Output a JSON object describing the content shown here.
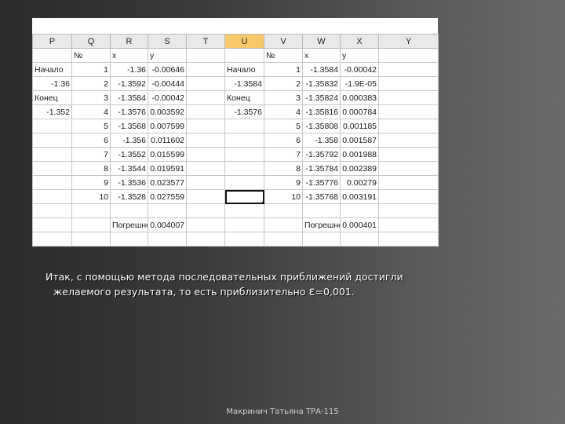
{
  "sheet": {
    "columns": [
      "P",
      "Q",
      "R",
      "S",
      "T",
      "U",
      "V",
      "W",
      "X",
      "Y"
    ],
    "highlighted_column": "U",
    "rows": [
      [
        "",
        "№",
        "x",
        "y",
        "",
        "",
        "№",
        "x",
        "y",
        ""
      ],
      [
        "Начало",
        "1",
        "-1.36",
        "-0.00646",
        "",
        "Начало",
        "1",
        "-1.3584",
        "-0.00042",
        ""
      ],
      [
        "-1.36",
        "2",
        "-1.3592",
        "-0.00444",
        "",
        "-1.3584",
        "2",
        "-1.35832",
        "-1.9E-05",
        ""
      ],
      [
        "Конец",
        "3",
        "-1.3584",
        "-0.00042",
        "",
        "Конец",
        "3",
        "-1.35824",
        "0.000383",
        ""
      ],
      [
        "-1.352",
        "4",
        "-1.3576",
        "0.003592",
        "",
        "-1.3576",
        "4",
        "-1.35816",
        "0.000784",
        ""
      ],
      [
        "",
        "5",
        "-1.3568",
        "0.007599",
        "",
        "",
        "5",
        "-1.35808",
        "0.001185",
        ""
      ],
      [
        "",
        "6",
        "-1.356",
        "0.011602",
        "",
        "",
        "6",
        "-1.358",
        "0.001587",
        ""
      ],
      [
        "",
        "7",
        "-1.3552",
        "0.015599",
        "",
        "",
        "7",
        "-1.35792",
        "0.001988",
        ""
      ],
      [
        "",
        "8",
        "-1.3544",
        "0.019591",
        "",
        "",
        "8",
        "-1.35784",
        "0.002389",
        ""
      ],
      [
        "",
        "9",
        "-1.3536",
        "0.023577",
        "",
        "",
        "9",
        "-1.35776",
        "0.00279",
        ""
      ],
      [
        "",
        "10",
        "-1.3528",
        "0.027559",
        "",
        "",
        "10",
        "-1.35768",
        "0.003191",
        ""
      ],
      [
        "",
        "",
        "",
        "",
        "",
        "",
        "",
        "",
        "",
        ""
      ],
      [
        "",
        "",
        "Погрешность",
        "0.004007",
        "",
        "",
        "",
        "Погрешность",
        "0.000401",
        ""
      ],
      [
        "",
        "",
        "",
        "",
        "",
        "",
        "",
        "",
        "",
        ""
      ]
    ]
  },
  "conclusion": {
    "line1": "Итак, с помощью метода последовательных приближений достигли",
    "line2": "желаемого результата, то есть приблизительно ",
    "epsilon": "ε",
    "value": "=0,001."
  },
  "footer": "Макринич Татьяна   ТРА-115"
}
